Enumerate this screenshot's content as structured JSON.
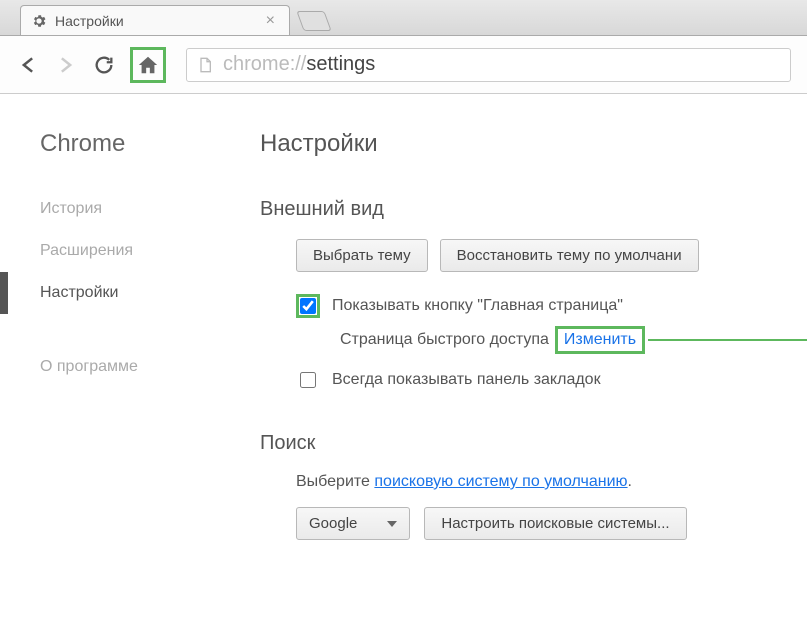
{
  "tab": {
    "title": "Настройки"
  },
  "url": {
    "prefix": "chrome://",
    "path": "settings"
  },
  "sidebar": {
    "title": "Chrome",
    "items": [
      {
        "label": "История"
      },
      {
        "label": "Расширения"
      },
      {
        "label": "Настройки"
      }
    ],
    "about": "О программе"
  },
  "main": {
    "title": "Настройки",
    "appearance": {
      "heading": "Внешний вид",
      "choose_theme": "Выбрать тему",
      "reset_theme": "Восстановить тему по умолчани",
      "show_home_label": "Показывать кнопку \"Главная страница\"",
      "ntp_label": "Страница быстрого доступа",
      "change_link": "Изменить",
      "bookmarks_label": "Всегда показывать панель закладок"
    },
    "search": {
      "heading": "Поиск",
      "desc_prefix": "Выберите ",
      "desc_link": "поисковую систему по умолчанию",
      "desc_suffix": ".",
      "engine": "Google",
      "manage": "Настроить поисковые системы..."
    }
  }
}
